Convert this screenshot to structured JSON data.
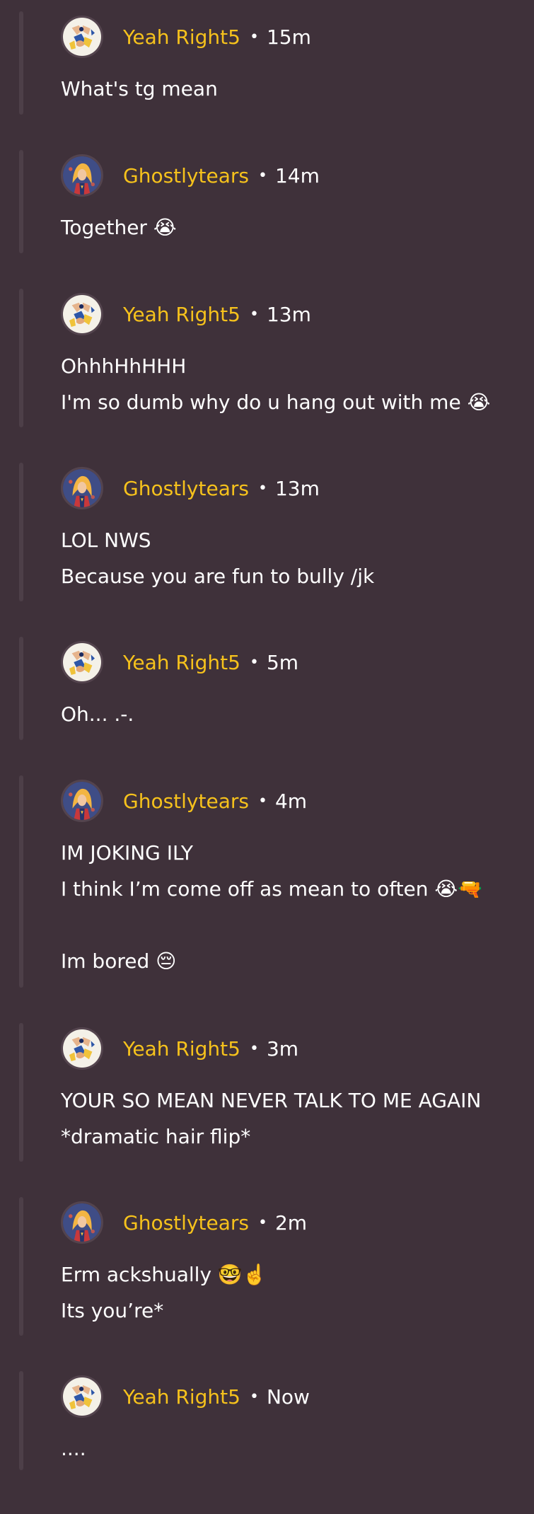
{
  "comments": [
    {
      "avatar": "yeah-right5-avatar",
      "author": "Yeah Right5",
      "separator": "•",
      "time": "15m",
      "lines": [
        "What's tg mean"
      ]
    },
    {
      "avatar": "ghostlytears-avatar",
      "author": "Ghostlytears",
      "separator": "•",
      "time": "14m",
      "lines": [
        "Together 😭"
      ]
    },
    {
      "avatar": "yeah-right5-avatar",
      "author": "Yeah Right5",
      "separator": "•",
      "time": "13m",
      "lines": [
        "OhhhHhHHH",
        "I'm so dumb why do u hang out with me 😭"
      ]
    },
    {
      "avatar": "ghostlytears-avatar",
      "author": "Ghostlytears",
      "separator": "•",
      "time": "13m",
      "lines": [
        "LOL NWS",
        "Because you are fun to bully /jk"
      ]
    },
    {
      "avatar": "yeah-right5-avatar",
      "author": "Yeah Right5",
      "separator": "•",
      "time": "5m",
      "lines": [
        "Oh... .-."
      ]
    },
    {
      "avatar": "ghostlytears-avatar",
      "author": "Ghostlytears",
      "separator": "•",
      "time": "4m",
      "lines": [
        "IM JOKING ILY",
        "I think I’m come off as mean to often 😭🔫",
        "",
        "Im bored 😔"
      ]
    },
    {
      "avatar": "yeah-right5-avatar",
      "author": "Yeah Right5",
      "separator": "•",
      "time": "3m",
      "lines": [
        "YOUR SO MEAN NEVER TALK TO ME AGAIN",
        "*dramatic hair flip*"
      ]
    },
    {
      "avatar": "ghostlytears-avatar",
      "author": "Ghostlytears",
      "separator": "•",
      "time": "2m",
      "lines": [
        "Erm ackshually 🤓☝️",
        "Its you’re*"
      ]
    },
    {
      "avatar": "yeah-right5-avatar",
      "author": "Yeah Right5",
      "separator": "•",
      "time": "Now",
      "lines": [
        "...."
      ]
    }
  ],
  "colors": {
    "background": "#3f313a",
    "thread_rail": "#4d3f48",
    "author": "#f6c21c",
    "text": "#ffffff"
  }
}
